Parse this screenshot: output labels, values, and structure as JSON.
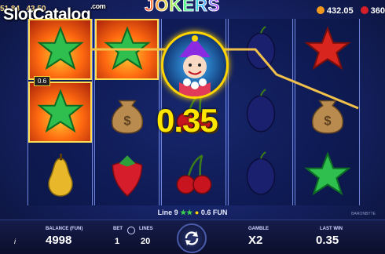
{
  "topbar": {
    "left_partial": "51.84",
    "left_partial2": "43.50",
    "watermark_main": "SlotCatalog",
    "watermark_suffix": ".com",
    "game_title": "JOKERS",
    "credits_value": "432.05",
    "gems_value": "360"
  },
  "reels": [
    [
      "green-star",
      "green-star",
      "pear"
    ],
    [
      "green-star",
      "money-bag",
      "strawberry"
    ],
    [
      "joker",
      "cherry",
      "cherry"
    ],
    [
      "plum",
      "plum",
      "plum"
    ],
    [
      "red-star",
      "money-bag",
      "green-star"
    ]
  ],
  "winning_cells": [
    [
      0,
      0
    ],
    [
      0,
      1
    ],
    [
      1,
      0
    ]
  ],
  "win_display": {
    "amount": "0.35",
    "mini_label": "0.6"
  },
  "line_info": {
    "line": "Line 9",
    "amount": "0.6 FUN"
  },
  "brand_small": "BARONBYTE",
  "bottom": {
    "balance_label": "BALANCE (FUN)",
    "balance_value": "4998",
    "bet_label": "BET",
    "bet_value": "1",
    "lines_label": "LINES",
    "lines_value": "20",
    "gamble_label": "GAMBLE",
    "gamble_value": "X2",
    "lastwin_label": "LAST WIN",
    "lastwin_value": "0.35",
    "info_symbol": "i"
  },
  "colors": {
    "win_yellow": "#ffe600",
    "accent_gold": "#ffd400",
    "bg_blue": "#17256b",
    "star_green": "#2fbf4f",
    "star_red": "#d8251e"
  }
}
